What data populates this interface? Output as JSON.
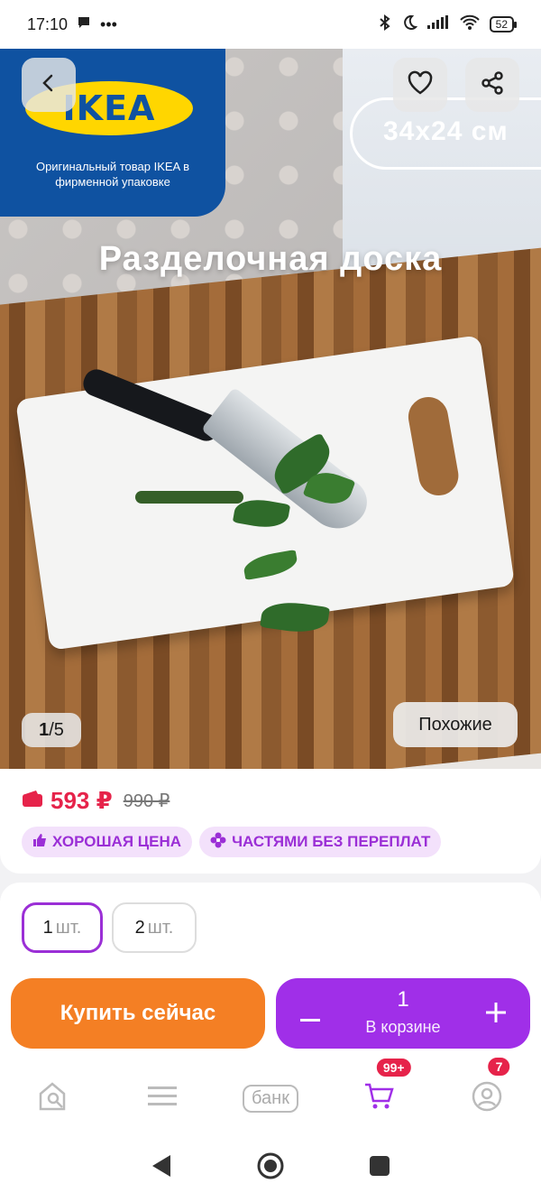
{
  "status_bar": {
    "time": "17:10",
    "battery": "52"
  },
  "hero": {
    "brand_logo": "IKEA",
    "brand_subtitle": "Оригинальный товар IKEA в фирменной упаковке",
    "size_label": "34x24 см",
    "headline": "Разделочная доска",
    "counter_current": "1",
    "counter_total": "/5",
    "similar_label": "Похожие"
  },
  "price": {
    "current": "593 ₽",
    "old": "990 ₽",
    "badges": [
      "ХОРОШАЯ ЦЕНА",
      "ЧАСТЯМИ БЕЗ ПЕРЕПЛАТ"
    ]
  },
  "quantity": {
    "options": [
      {
        "value": "1",
        "unit": "шт."
      },
      {
        "value": "2",
        "unit": "шт."
      }
    ],
    "selected_index": 0
  },
  "actions": {
    "buy_now": "Купить сейчас",
    "cart_count": "1",
    "cart_label": "В корзине"
  },
  "tabbar": {
    "bank_label": "банк",
    "cart_badge": "99+",
    "profile_badge": "7"
  },
  "colors": {
    "accent_purple": "#a02fe8",
    "price_red": "#e6234a",
    "buy_orange": "#f47f24",
    "ikea_blue": "#0f52a1",
    "ikea_yellow": "#ffd600"
  }
}
